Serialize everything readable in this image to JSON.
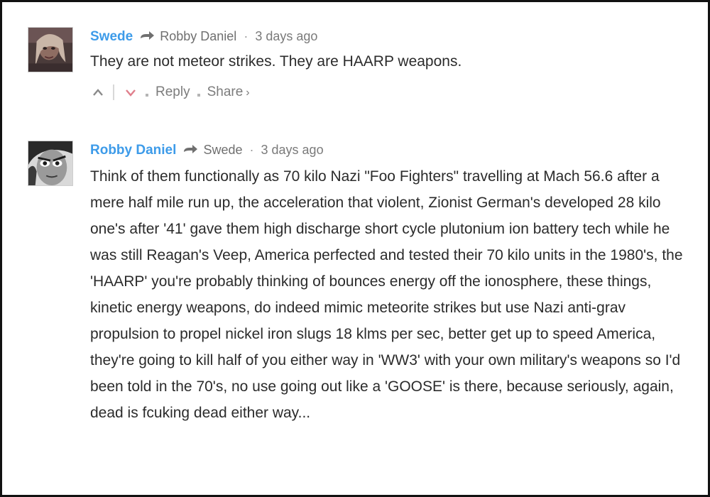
{
  "comments": [
    {
      "author": "Swede",
      "reply_to": "Robby Daniel",
      "separator": "·",
      "time": "3 days ago",
      "text": "They are not meteor strikes. They are HAARP weapons.",
      "actions": {
        "upvote_icon": "chevron-up-icon",
        "downvote_icon": "chevron-down-icon",
        "reply_label": "Reply",
        "share_label": "Share",
        "share_chevron": "›"
      }
    },
    {
      "author": "Robby Daniel",
      "reply_to": "Swede",
      "separator": "·",
      "time": "3 days ago",
      "text": "Think of them functionally as 70 kilo Nazi \"Foo Fighters\" travelling at Mach 56.6 after a mere half mile run up, the acceleration that violent, Zionist German's developed 28 kilo one's after '41' gave them high discharge short cycle plutonium ion battery tech while he was still Reagan's Veep, America perfected and tested their 70 kilo units in the 1980's, the 'HAARP' you're probably thinking of bounces energy off the ionosphere, these things, kinetic energy weapons, do indeed mimic meteorite strikes but use Nazi anti-grav propulsion to propel nickel iron slugs 18 klms per sec, better get up to speed America, they're going to kill half of you either way in 'WW3' with your own military's weapons so I'd been told in the 70's, no use going out like a 'GOOSE' is there, because seriously, again, dead is fcuking dead either way..."
    }
  ],
  "colors": {
    "author": "#3d9be9",
    "meta": "#7a7a7a",
    "text": "#2b2b2b",
    "downvote": "#e07f8c",
    "upvote": "#8a8a8a",
    "border": "#111111"
  }
}
